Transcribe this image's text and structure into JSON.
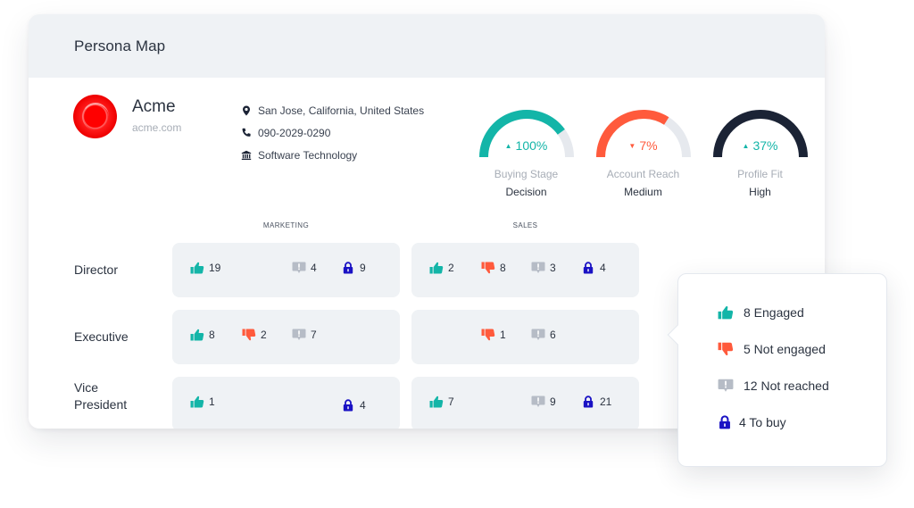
{
  "header": {
    "title": "Persona Map"
  },
  "company": {
    "name": "Acme",
    "domain": "acme.com",
    "logo_color": "#ff0000",
    "details": [
      {
        "icon": "map-pin-icon",
        "text": "San Jose, California, United States"
      },
      {
        "icon": "phone-icon",
        "text": "090-2029-0290"
      },
      {
        "icon": "bank-icon",
        "text": "Software Technology"
      }
    ]
  },
  "gauges": [
    {
      "label": "Buying Stage",
      "value": "Decision",
      "change": "100%",
      "direction": "up",
      "fill_fraction": 0.8,
      "color": "#13b5a8"
    },
    {
      "label": "Account Reach",
      "value": "Medium",
      "change": "7%",
      "direction": "down",
      "fill_fraction": 0.68,
      "color": "#ff5a3c"
    },
    {
      "label": "Profile Fit",
      "value": "High",
      "change": "37%",
      "direction": "up",
      "fill_fraction": 1.0,
      "color": "#1b2335"
    }
  ],
  "columns": [
    "MARKETING",
    "SALES"
  ],
  "rows": [
    {
      "label": "Director",
      "marketing": {
        "engaged": "19",
        "not_engaged": null,
        "not_reached": "4",
        "to_buy": "9"
      },
      "sales": {
        "engaged": "2",
        "not_engaged": "8",
        "not_reached": "3",
        "to_buy": "4"
      }
    },
    {
      "label": "Executive",
      "marketing": {
        "engaged": "8",
        "not_engaged": "2",
        "not_reached": "7",
        "to_buy": null
      },
      "sales": {
        "engaged": null,
        "not_engaged": "1",
        "not_reached": "6",
        "to_buy": null
      }
    },
    {
      "label": "Vice President",
      "marketing": {
        "engaged": "1",
        "not_engaged": null,
        "not_reached": null,
        "to_buy": "4"
      },
      "sales": {
        "engaged": "7",
        "not_engaged": null,
        "not_reached": "9",
        "to_buy": "21"
      }
    }
  ],
  "legend": [
    {
      "icon": "thumbs-up-icon",
      "text": "8 Engaged"
    },
    {
      "icon": "thumbs-down-icon",
      "text": "5 Not engaged"
    },
    {
      "icon": "alert-comment-icon",
      "text": "12 Not reached"
    },
    {
      "icon": "lock-icon",
      "text": "4 To buy"
    }
  ],
  "colors": {
    "engaged": "#13b5a8",
    "not_engaged": "#ff5a3c",
    "not_reached": "#b6bcc6",
    "to_buy": "#1a12c4",
    "up": "#13b5a8",
    "down": "#ff5a3c"
  }
}
